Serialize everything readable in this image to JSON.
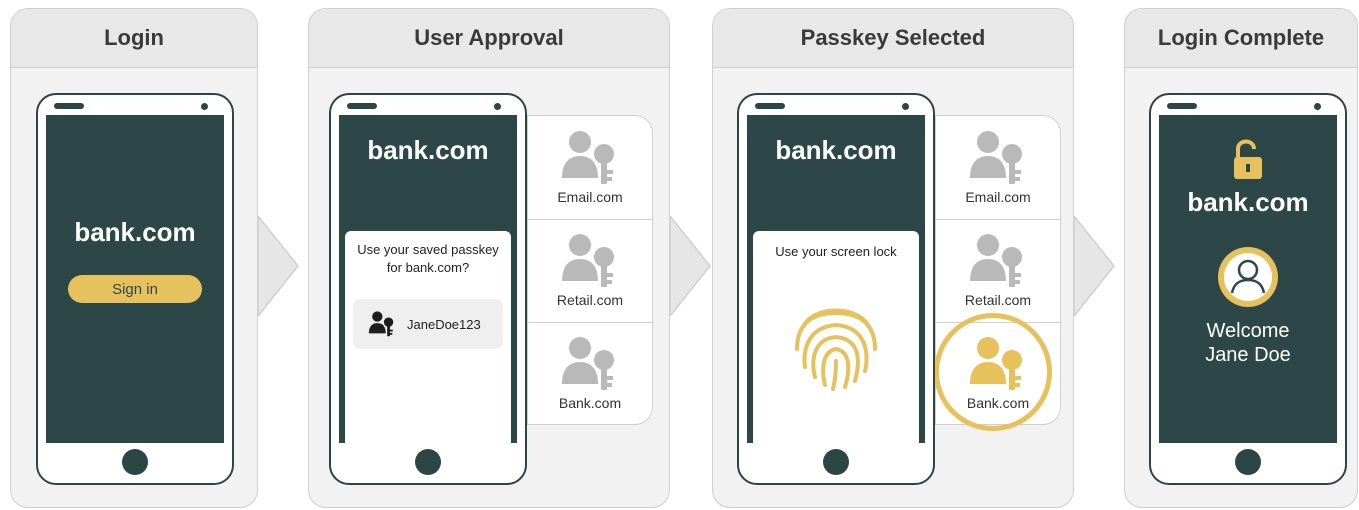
{
  "colors": {
    "dark_teal": "#2d4647",
    "gold": "#e6c15c",
    "gray_icon": "#b9b9b9",
    "panel_bg": "#f2f2f2"
  },
  "panels": [
    {
      "title": "Login"
    },
    {
      "title": "User Approval"
    },
    {
      "title": "Passkey Selected"
    },
    {
      "title": "Login Complete"
    }
  ],
  "login": {
    "site": "bank.com",
    "button": "Sign in"
  },
  "approval": {
    "site": "bank.com",
    "prompt": "Use your saved passkey for bank.com?",
    "username": "JaneDoe123",
    "passkeys": [
      "Email.com",
      "Retail.com",
      "Bank.com"
    ],
    "icon": "user-key-icon"
  },
  "selected": {
    "site": "bank.com",
    "prompt": "Use your screen lock",
    "passkeys": [
      "Email.com",
      "Retail.com",
      "Bank.com"
    ],
    "selected_passkey": "Bank.com",
    "icon": "fingerprint-icon"
  },
  "complete": {
    "site": "bank.com",
    "welcome_line1": "Welcome",
    "welcome_line2": "Jane Doe",
    "icon": "unlocked-padlock-icon"
  }
}
